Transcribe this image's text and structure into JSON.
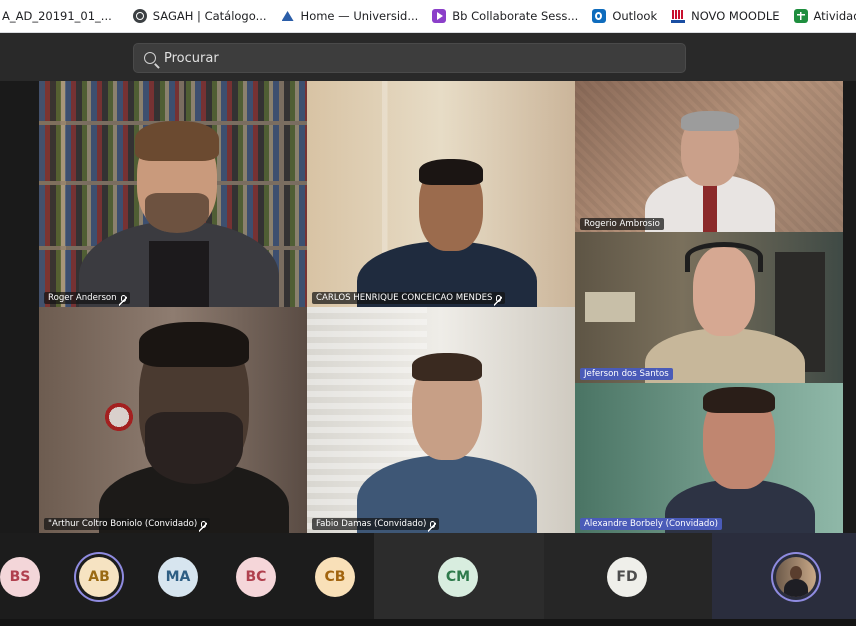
{
  "bookmarks": [
    {
      "label": "A_AD_20191_01_...",
      "icon": "none"
    },
    {
      "label": "SAGAH | Catálogo...",
      "icon": "globe-icon"
    },
    {
      "label": "Home — Universid...",
      "icon": "azure-devops-icon"
    },
    {
      "label": "Bb Collaborate Sess...",
      "icon": "blackboard-icon"
    },
    {
      "label": "Outlook",
      "icon": "outlook-icon"
    },
    {
      "label": "NOVO MOODLE",
      "icon": "moodle-icon"
    },
    {
      "label": "Atividades_Comple...",
      "icon": "sheets-icon"
    }
  ],
  "search": {
    "placeholder": "Procurar"
  },
  "participants": [
    {
      "name": "Roger Anderson",
      "muted": true
    },
    {
      "name": "CARLOS HENRIQUE CONCEICAO MENDES",
      "muted": true
    },
    {
      "name": "Rogerio Ambrosio",
      "muted": false
    },
    {
      "name": "Jeferson dos Santos",
      "muted": false
    },
    {
      "name": "\"Arthur Coltro Boniolo (Convidado)",
      "muted": true
    },
    {
      "name": "Fabio Damas (Convidado)",
      "muted": true
    },
    {
      "name": "Alexandre Borbely (Convidado)",
      "muted": false
    }
  ],
  "avatars": [
    {
      "initials": "BS",
      "bg": "#f3d6d9",
      "fg": "#b0404e"
    },
    {
      "initials": "AB",
      "bg": "#f6e3c2",
      "fg": "#9a6a14",
      "selected": true
    },
    {
      "initials": "MA",
      "bg": "#d7e5ef",
      "fg": "#2f5f84"
    },
    {
      "initials": "BC",
      "bg": "#f5d6d9",
      "fg": "#b0404e"
    },
    {
      "initials": "CB",
      "bg": "#f9e0b8",
      "fg": "#a2640e"
    },
    {
      "initials": "CM",
      "bg": "#d8eddf",
      "fg": "#2e7a4b"
    },
    {
      "initials": "FD",
      "bg": "#efefea",
      "fg": "#4d4d4d"
    }
  ],
  "colors": {
    "accent": "#8f8be0",
    "label_highlight": "#4a5bb8"
  }
}
